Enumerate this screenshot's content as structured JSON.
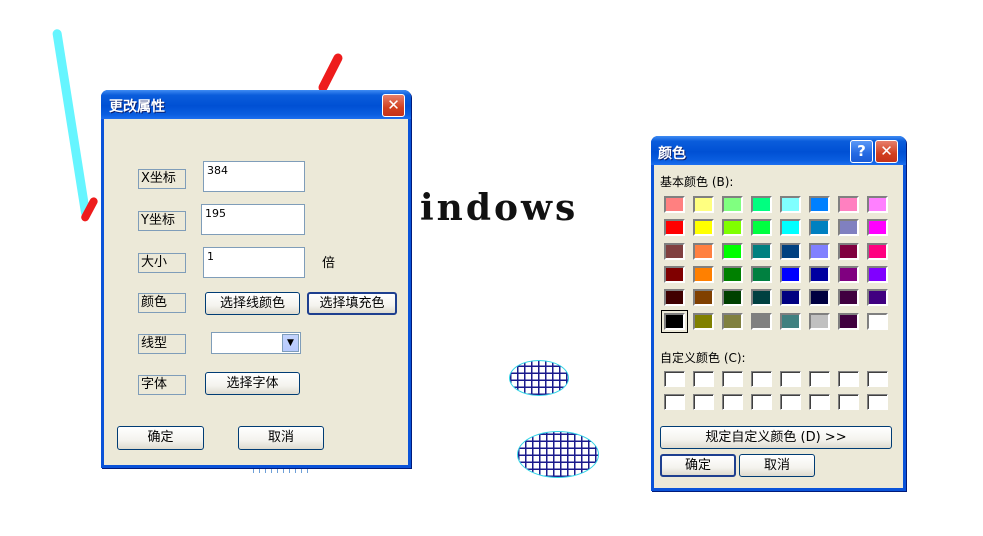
{
  "canvas": {
    "text": "indows",
    "colors": {
      "cyan_line": "#66f5ff",
      "red_line": "#ee1c1c",
      "hatch": "#1a1a8c",
      "hatch_border": "#33d4e6"
    }
  },
  "properties_dialog": {
    "title": "更改属性",
    "x_label": "X坐标",
    "x_value": "384",
    "y_label": "Y坐标",
    "y_value": "195",
    "size_label": "大小",
    "size_value": "1",
    "size_unit": "倍",
    "color_label": "颜色",
    "line_color_button": "选择线颜色",
    "fill_color_button": "选择填充色",
    "linetype_label": "线型",
    "linetype_value": "",
    "font_label": "字体",
    "font_button": "选择字体",
    "ok_button": "确定",
    "cancel_button": "取消"
  },
  "color_dialog": {
    "title": "颜色",
    "basic_colors_label": "基本颜色 (B):",
    "custom_colors_label": "自定义颜色 (C):",
    "define_custom_button": "规定自定义颜色 (D) >>",
    "ok_button": "确定",
    "cancel_button": "取消",
    "selected_color": "#000000",
    "basic_colors": [
      [
        "#ff8080",
        "#ffff80",
        "#80ff80",
        "#00ff80",
        "#80ffff",
        "#0080ff",
        "#ff80c0",
        "#ff80ff"
      ],
      [
        "#ff0000",
        "#ffff00",
        "#80ff00",
        "#00ff40",
        "#00ffff",
        "#0080c0",
        "#8080c0",
        "#ff00ff"
      ],
      [
        "#804040",
        "#ff8040",
        "#00ff00",
        "#008080",
        "#004080",
        "#8080ff",
        "#800040",
        "#ff0080"
      ],
      [
        "#800000",
        "#ff8000",
        "#008000",
        "#008040",
        "#0000ff",
        "#0000a0",
        "#800080",
        "#8000ff"
      ],
      [
        "#400000",
        "#804000",
        "#004000",
        "#004040",
        "#000080",
        "#000040",
        "#400040",
        "#400080"
      ],
      [
        "#000000",
        "#808000",
        "#808040",
        "#808080",
        "#408080",
        "#c0c0c0",
        "#400040",
        "#ffffff"
      ]
    ],
    "custom_colors": [
      [
        "#ffffff",
        "#ffffff",
        "#ffffff",
        "#ffffff",
        "#ffffff",
        "#ffffff",
        "#ffffff",
        "#ffffff"
      ],
      [
        "#ffffff",
        "#ffffff",
        "#ffffff",
        "#ffffff",
        "#ffffff",
        "#ffffff",
        "#ffffff",
        "#ffffff"
      ]
    ],
    "icons": {
      "help": "help-icon",
      "close": "close-icon"
    }
  }
}
